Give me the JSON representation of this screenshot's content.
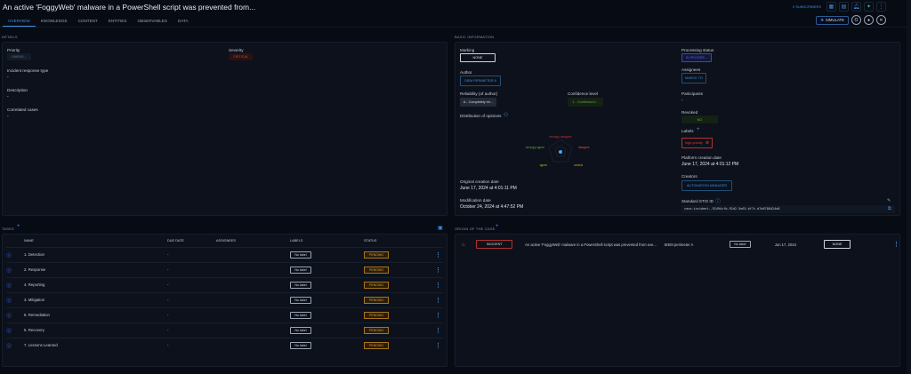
{
  "header": {
    "title": "An active 'FoggyWeb' malware in a PowerShell script was prevented from...",
    "subscribers": "0 SUBSCRIBERS",
    "simulate_label": "SIMULATE"
  },
  "tabs": [
    "OVERVIEW",
    "KNOWLEDGE",
    "CONTENT",
    "ENTITIES",
    "OBSERVABLES",
    "DATA"
  ],
  "details": {
    "section": "DETAILS",
    "priority_label": "Priority",
    "priority": "UNKNO...",
    "severity_label": "Severity",
    "severity": "CRITICAL",
    "response_type_label": "Incident response type",
    "response_type": "-",
    "description_label": "Description",
    "description": "-",
    "correlated_label": "Correlated cases",
    "correlated": "-"
  },
  "basic": {
    "section": "BASIC INFORMATION",
    "marking_label": "Marking",
    "marking": "NONE",
    "author_label": "Author",
    "author": "SIEM PERIMETER A",
    "reliability_label": "Reliability (of author)",
    "reliability": "A - Completely rel...",
    "confidence_label": "Confidence level",
    "confidence": "1 - Confirmed b...",
    "opinions_label": "Distribution of opinions",
    "opinions": {
      "strongly_disagree": "strongly-disagree",
      "disagree": "disagree",
      "neutral": "neutral",
      "agree": "agree",
      "strongly_agree": "strongly-agree"
    },
    "original_date_label": "Original creation date",
    "original_date": "June 17, 2024 at 4:01:11 PM",
    "modification_label": "Modification date",
    "modification": "October 24, 2024 at 4:47:52 PM",
    "processing_label": "Processing status",
    "processing": "IN PROGRE...",
    "assignees_label": "Assignees",
    "assignee": "MARCK TO",
    "participants_label": "Participants",
    "participants": "-",
    "revoked_label": "Revoked",
    "revoked": "NO",
    "labels_label": "Labels",
    "label": "high-priority",
    "platform_date_label": "Platform creation date",
    "platform_date": "June 17, 2024 at 4:01:12 PM",
    "creators_label": "Creators",
    "creator": "AUTOMATION MANAGER",
    "stix_label": "Standard STIX ID",
    "stix": "case-incident--92494cfb-92d2-5e63-bf7c-d7e8780424a8"
  },
  "tasks": {
    "section": "TASKS",
    "columns": [
      "NAME",
      "DUE DATE",
      "ASSIGNEES",
      "LABELS",
      "STATUS"
    ],
    "rows": [
      {
        "name": "1. Detection",
        "due": "-",
        "label": "No label",
        "status": "PENDING"
      },
      {
        "name": "2. Response",
        "due": "-",
        "label": "No label",
        "status": "PENDING"
      },
      {
        "name": "4. Reporting",
        "due": "-",
        "label": "No label",
        "status": "PENDING"
      },
      {
        "name": "3. Mitigation",
        "due": "-",
        "label": "No label",
        "status": "PENDING"
      },
      {
        "name": "6. Remediation",
        "due": "-",
        "label": "No label",
        "status": "PENDING"
      },
      {
        "name": "5. Recovery",
        "due": "-",
        "label": "No label",
        "status": "PENDING"
      },
      {
        "name": "7. Lessons Learned",
        "due": "-",
        "label": "No label",
        "status": "PENDING"
      }
    ]
  },
  "origin": {
    "section": "ORIGIN OF THE CASE",
    "type": "INCIDENT",
    "name": "An active 'FoggyWeb' malware in a PowerShell script was prevented from exe...",
    "author": "SIEM perimeter A",
    "label": "No label",
    "date": "Jun 17, 2024",
    "marking": "NONE"
  }
}
